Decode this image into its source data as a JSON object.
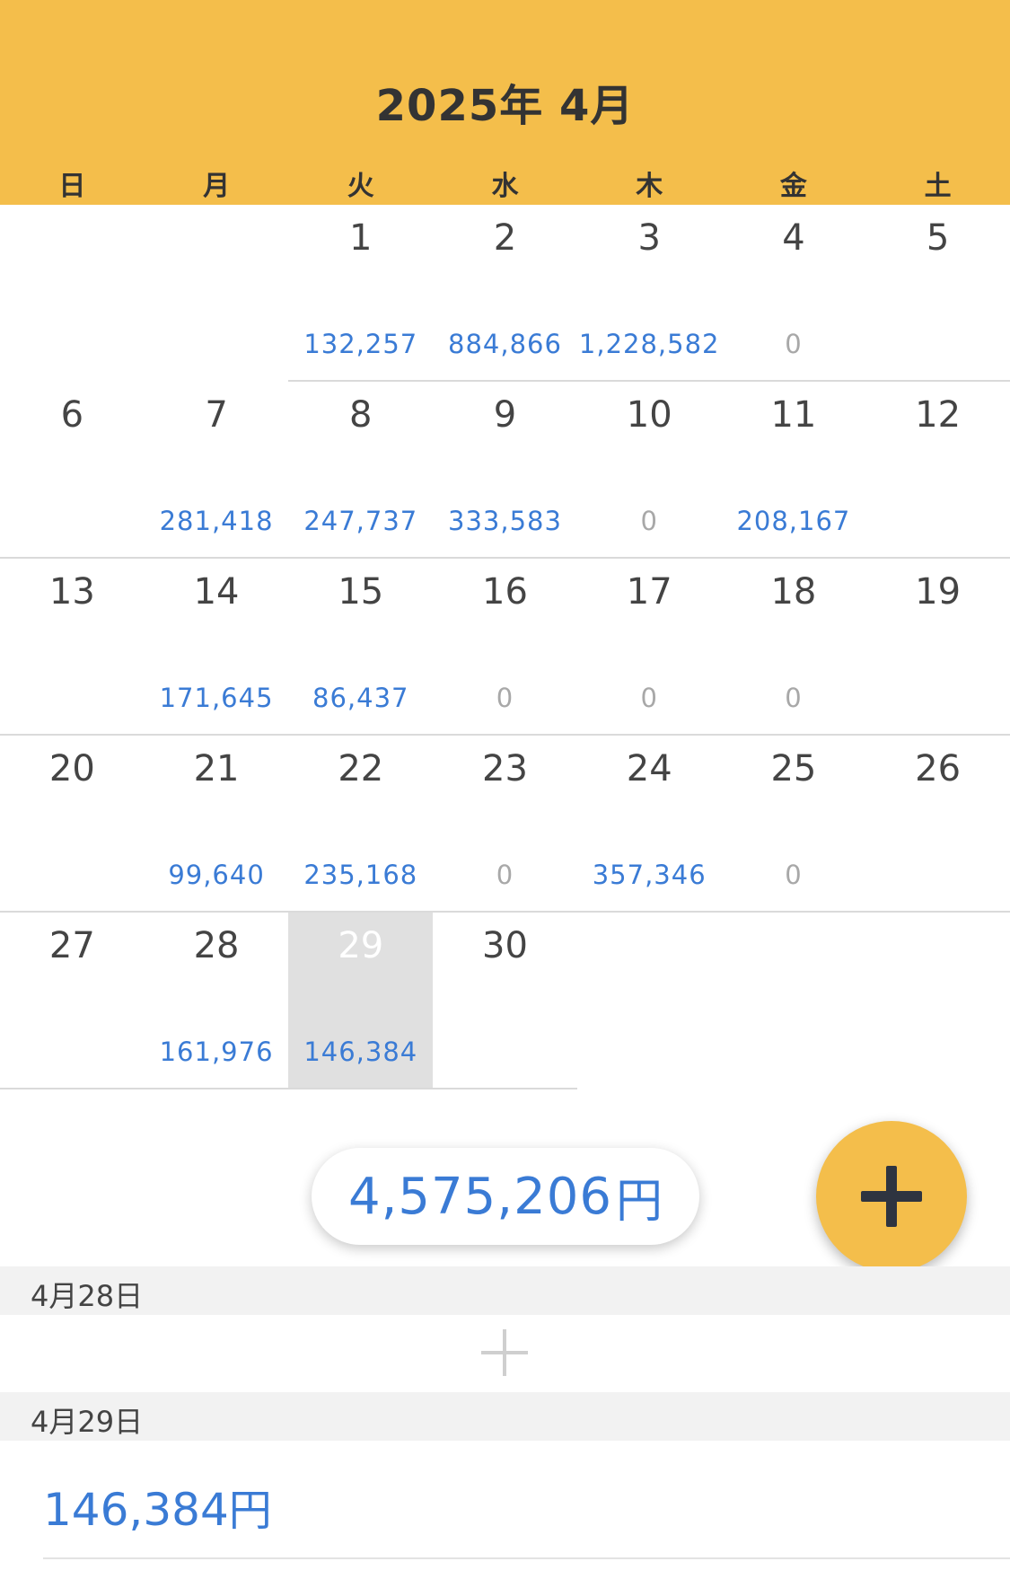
{
  "header": {
    "month_title": "2025年 4月",
    "weekdays": [
      "日",
      "月",
      "火",
      "水",
      "木",
      "金",
      "土"
    ]
  },
  "calendar": {
    "weeks": [
      [
        {
          "day": "",
          "amount": ""
        },
        {
          "day": "",
          "amount": ""
        },
        {
          "day": "1",
          "amount": "132,257"
        },
        {
          "day": "2",
          "amount": "884,866"
        },
        {
          "day": "3",
          "amount": "1,228,582"
        },
        {
          "day": "4",
          "amount": "0"
        },
        {
          "day": "5",
          "amount": ""
        }
      ],
      [
        {
          "day": "6",
          "amount": ""
        },
        {
          "day": "7",
          "amount": "281,418"
        },
        {
          "day": "8",
          "amount": "247,737"
        },
        {
          "day": "9",
          "amount": "333,583"
        },
        {
          "day": "10",
          "amount": "0"
        },
        {
          "day": "11",
          "amount": "208,167"
        },
        {
          "day": "12",
          "amount": ""
        }
      ],
      [
        {
          "day": "13",
          "amount": ""
        },
        {
          "day": "14",
          "amount": "171,645"
        },
        {
          "day": "15",
          "amount": "86,437"
        },
        {
          "day": "16",
          "amount": "0"
        },
        {
          "day": "17",
          "amount": "0"
        },
        {
          "day": "18",
          "amount": "0"
        },
        {
          "day": "19",
          "amount": ""
        }
      ],
      [
        {
          "day": "20",
          "amount": ""
        },
        {
          "day": "21",
          "amount": "99,640"
        },
        {
          "day": "22",
          "amount": "235,168"
        },
        {
          "day": "23",
          "amount": "0"
        },
        {
          "day": "24",
          "amount": "357,346"
        },
        {
          "day": "25",
          "amount": "0"
        },
        {
          "day": "26",
          "amount": ""
        }
      ],
      [
        {
          "day": "27",
          "amount": ""
        },
        {
          "day": "28",
          "amount": "161,976"
        },
        {
          "day": "29",
          "amount": "146,384"
        },
        {
          "day": "30",
          "amount": ""
        },
        {
          "day": "",
          "amount": ""
        },
        {
          "day": "",
          "amount": ""
        },
        {
          "day": "",
          "amount": ""
        }
      ]
    ],
    "selected_day": "29"
  },
  "total": {
    "amount": "4,575,206",
    "unit": "円"
  },
  "fab": {
    "icon": "plus-icon"
  },
  "sections": [
    {
      "date_label": "4月28日"
    },
    {
      "date_label": "4月29日",
      "entry_amount": "146,384",
      "entry_unit": "円"
    }
  ],
  "colors": {
    "accent": "#F4BE4B",
    "amount_blue": "#3A7BD5",
    "zero_gray": "#A8A8A8",
    "selected_bg": "#E0E0E0"
  }
}
